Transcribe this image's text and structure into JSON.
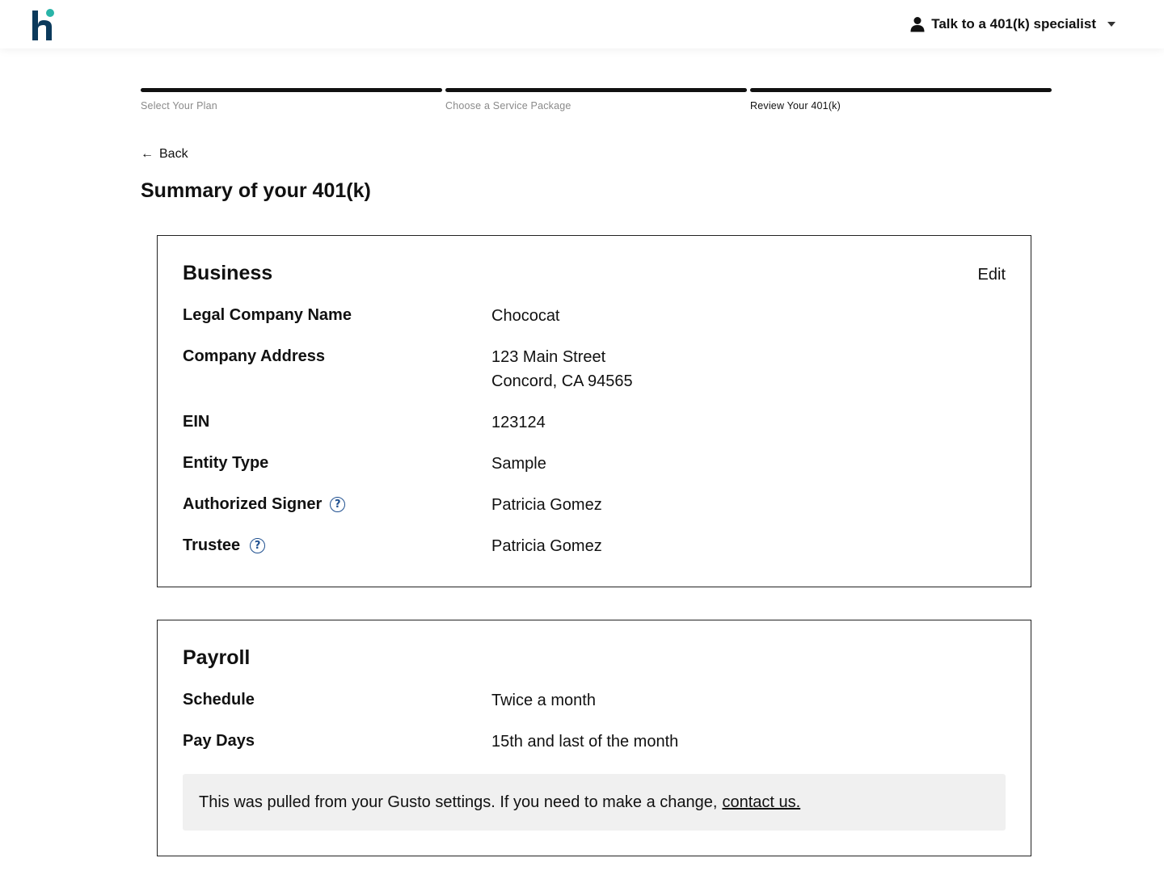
{
  "header": {
    "logo_letter": "h",
    "specialist_label": "Talk to a 401(k) specialist",
    "icons": {
      "user": "person-icon",
      "caret": "caret-down-icon"
    },
    "brand_colors": {
      "logo_dark": "#0b3a5c",
      "logo_dot": "#29b4a8"
    }
  },
  "steps": [
    {
      "label": "Select Your Plan",
      "state": "complete"
    },
    {
      "label": "Choose a Service Package",
      "state": "complete"
    },
    {
      "label": "Review Your 401(k)",
      "state": "current"
    }
  ],
  "back_label": "Back",
  "page_title": "Summary of your 401(k)",
  "business": {
    "title": "Business",
    "edit_label": "Edit",
    "rows": [
      {
        "label": "Legal Company Name",
        "value": "Chococat"
      },
      {
        "label": "Company Address",
        "value_line1": "123 Main Street",
        "value_line2": "Concord, CA 94565"
      },
      {
        "label": "EIN",
        "value": "123124"
      },
      {
        "label": "Entity Type",
        "value": "Sample"
      },
      {
        "label": "Authorized Signer",
        "value": "Patricia Gomez",
        "help": "?"
      },
      {
        "label": "Trustee",
        "value": "Patricia Gomez",
        "help": "?"
      }
    ]
  },
  "payroll": {
    "title": "Payroll",
    "rows": [
      {
        "label": "Schedule",
        "value": "Twice a month"
      },
      {
        "label": "Pay Days",
        "value": "15th and last of the month"
      }
    ],
    "notice_text": "This was pulled from your Gusto settings. If you need to make a change,",
    "notice_link": "contact us."
  }
}
